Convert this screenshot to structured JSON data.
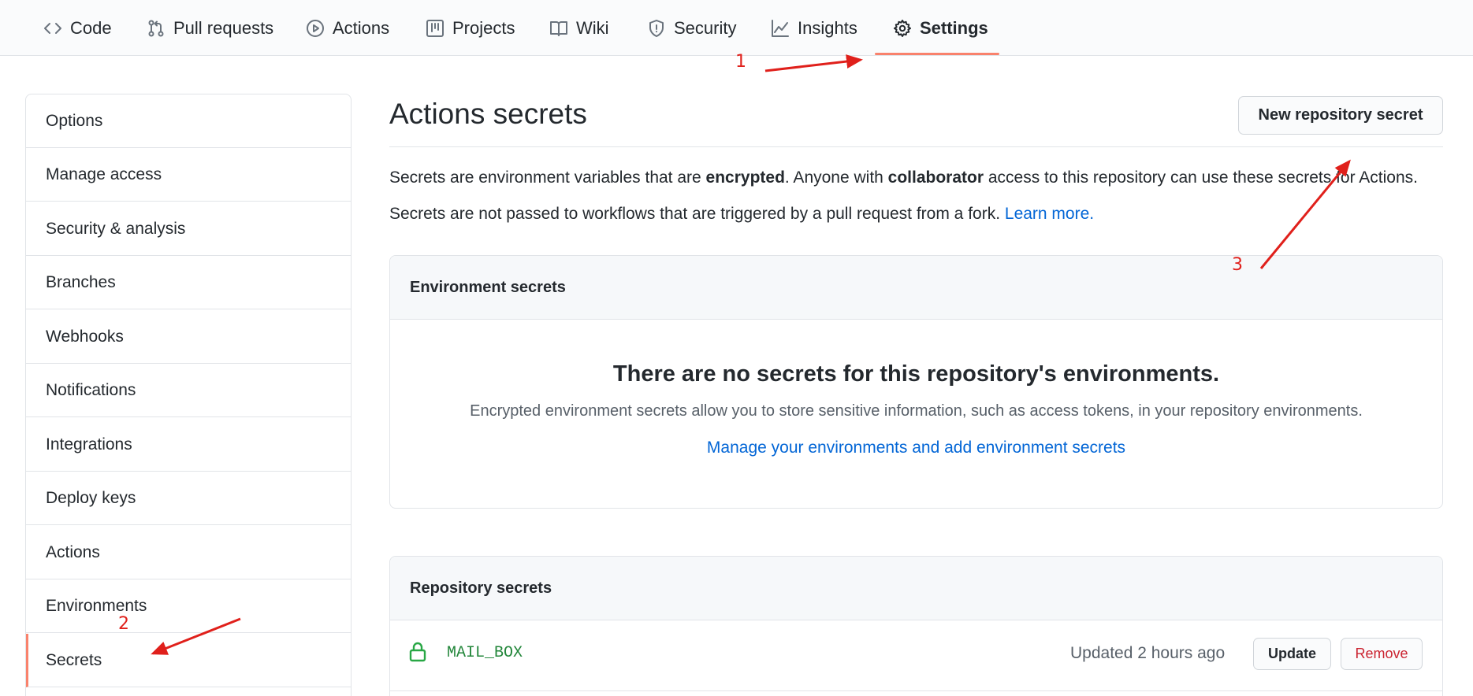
{
  "nav": {
    "tabs": [
      {
        "label": "Code",
        "icon": "code-icon"
      },
      {
        "label": "Pull requests",
        "icon": "pull-request-icon"
      },
      {
        "label": "Actions",
        "icon": "play-icon"
      },
      {
        "label": "Projects",
        "icon": "project-icon"
      },
      {
        "label": "Wiki",
        "icon": "book-icon"
      },
      {
        "label": "Security",
        "icon": "shield-icon"
      },
      {
        "label": "Insights",
        "icon": "graph-icon"
      },
      {
        "label": "Settings",
        "icon": "gear-icon",
        "selected": true
      }
    ]
  },
  "sidebar": {
    "items": [
      {
        "label": "Options"
      },
      {
        "label": "Manage access"
      },
      {
        "label": "Security & analysis"
      },
      {
        "label": "Branches"
      },
      {
        "label": "Webhooks"
      },
      {
        "label": "Notifications"
      },
      {
        "label": "Integrations"
      },
      {
        "label": "Deploy keys"
      },
      {
        "label": "Actions"
      },
      {
        "label": "Environments"
      },
      {
        "label": "Secrets",
        "selected": true
      }
    ]
  },
  "main": {
    "title": "Actions secrets",
    "new_secret_label": "New repository secret",
    "desc1": {
      "p1": "Secrets are environment variables that are ",
      "b1": "encrypted",
      "p2": ". Anyone with ",
      "b2": "collaborator",
      "p3": " access to this repository can use these secrets for Actions."
    },
    "desc2": {
      "text": "Secrets are not passed to workflows that are triggered by a pull request from a fork. ",
      "link": "Learn more."
    },
    "env_box": {
      "header": "Environment secrets",
      "blank_title": "There are no secrets for this repository's environments.",
      "blank_desc": "Encrypted environment secrets allow you to store sensitive information, such as access tokens, in your repository environments.",
      "blank_link": "Manage your environments and add environment secrets"
    },
    "repo_box": {
      "header": "Repository secrets",
      "secrets": [
        {
          "name": "MAIL_BOX",
          "updated": "Updated 2 hours ago",
          "update_label": "Update",
          "remove_label": "Remove"
        }
      ]
    }
  },
  "annotations": {
    "n1": "1",
    "n2": "2",
    "n3": "3",
    "color": "#e0201b"
  },
  "colors": {
    "accent_underline": "#f9826c",
    "link": "#0366d6",
    "secret_green": "#22863a",
    "danger": "#cb2431"
  }
}
